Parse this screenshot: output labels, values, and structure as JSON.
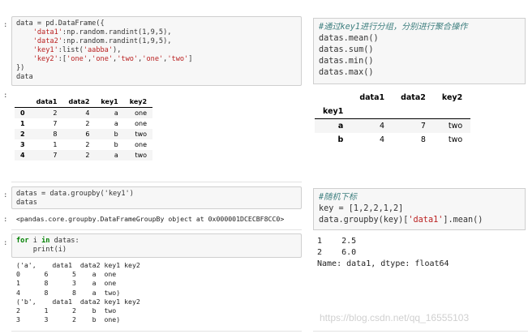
{
  "left": {
    "cell1": {
      "prompt": ":",
      "lines": [
        [
          "",
          "data = pd.DataFrame({"
        ],
        [
          "s",
          "    'data1':np.random.randint(1,9,5),"
        ],
        [
          "s",
          "    'data2':np.random.randint(1,9,5),"
        ],
        [
          "s",
          "    'key1':list('aabba'),"
        ],
        [
          "s",
          "    'key2':['one','one','two','one','two']"
        ],
        [
          "",
          "})"
        ],
        [
          "",
          "data"
        ]
      ]
    },
    "table1": {
      "prompt": ":",
      "columns": [
        "data1",
        "data2",
        "key1",
        "key2"
      ],
      "rows": [
        [
          "0",
          "2",
          "4",
          "a",
          "one"
        ],
        [
          "1",
          "7",
          "2",
          "a",
          "one"
        ],
        [
          "2",
          "8",
          "6",
          "b",
          "two"
        ],
        [
          "3",
          "1",
          "2",
          "b",
          "one"
        ],
        [
          "4",
          "7",
          "2",
          "a",
          "two"
        ]
      ]
    },
    "cell2": {
      "prompt": ":",
      "lines": [
        "datas = data.groupby('key1')",
        "datas"
      ]
    },
    "out2": {
      "prompt": ":",
      "text": "<pandas.core.groupby.DataFrameGroupBy object at 0x000001DCECBF8CC0>"
    },
    "cell3": {
      "prompt": ":",
      "line1_kw1": "for",
      "line1_mid": " i ",
      "line1_kw2": "in",
      "line1_end": " datas:",
      "line2": "    print(i)"
    },
    "out3": {
      "lines": [
        "('a',    data1  data2 key1 key2",
        "0      6      5    a  one",
        "1      8      3    a  one",
        "4      8      8    a  two)",
        "('b',    data1  data2 key1 key2",
        "2      1      2    b  two",
        "3      3      2    b  one)"
      ]
    }
  },
  "right": {
    "cell1": {
      "comment": "#通过key1进行分组，分别进行聚合操作",
      "lines": [
        "datas.mean()",
        "datas.sum()",
        "datas.min()",
        "datas.max()"
      ]
    },
    "table": {
      "columns": [
        "data1",
        "data2",
        "key2"
      ],
      "index_name": "key1",
      "rows": [
        [
          "a",
          "4",
          "7",
          "two"
        ],
        [
          "b",
          "4",
          "8",
          "two"
        ]
      ]
    },
    "cell2": {
      "comment": "#随机下标",
      "line1": "key = [1,2,2,1,2]",
      "line2_a": "data.groupby(key)[",
      "line2_s": "'data1'",
      "line2_b": "].mean()"
    },
    "out2": {
      "lines": [
        "1    2.5",
        "2    6.0",
        "Name: data1, dtype: float64"
      ]
    }
  },
  "watermark": "https://blog.csdn.net/qq_16555103"
}
